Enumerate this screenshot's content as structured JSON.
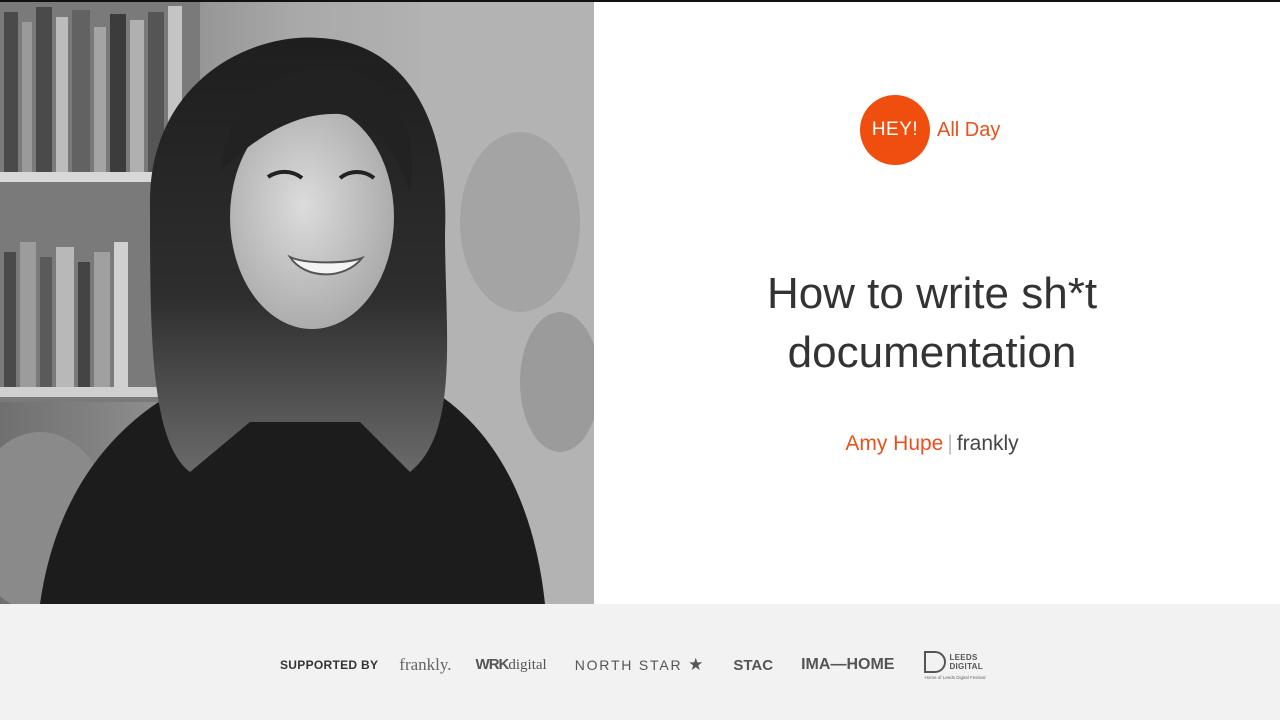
{
  "event": {
    "logo_badge": "HEY!",
    "logo_name": "All Day",
    "accent_color": "#f04e0f"
  },
  "talk": {
    "title_line1": "How to write sh*t",
    "title_line2": "documentation"
  },
  "speaker": {
    "name": "Amy Hupe",
    "separator": "|",
    "company": "frankly"
  },
  "footer": {
    "supported_label": "SUPPORTED BY",
    "sponsors": {
      "frankly": "frankly.",
      "wrk_bold": "WRK",
      "wrk_rest": "digital",
      "north_star": "NORTH STAR",
      "north_star_icon": "star-icon",
      "stac": "STAC",
      "ima_home": "IMA—HOME",
      "leeds_line1": "LEEDS",
      "leeds_line2": "DIGITAL",
      "leeds_tagline": "Home of Leeds Digital Festival"
    }
  },
  "photo": {
    "description_icon": "speaker-photo"
  }
}
